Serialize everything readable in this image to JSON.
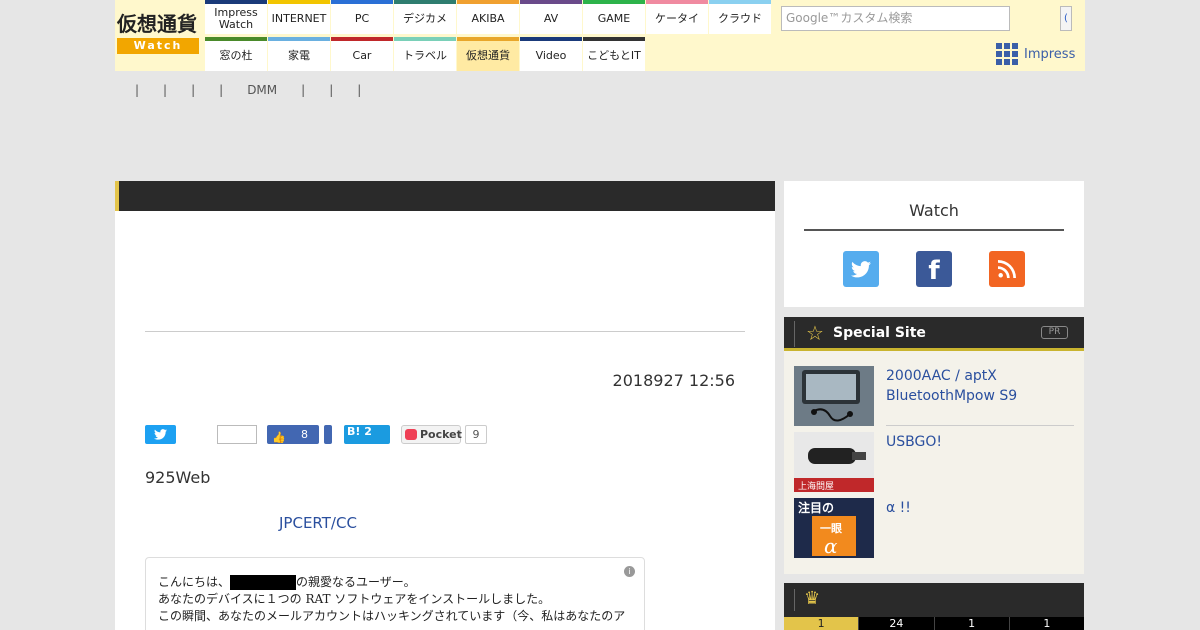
{
  "header": {
    "logo_text": "仮想通貨",
    "logo_sub": "Watch",
    "nav_row1": [
      {
        "label": "Impress\nWatch",
        "color": "#1a3a7a"
      },
      {
        "label": "INTERNET",
        "color": "#f2c500"
      },
      {
        "label": "PC",
        "color": "#2a6fd6"
      },
      {
        "label": "デジカメ",
        "color": "#2e7d6f"
      },
      {
        "label": "AKIBA",
        "color": "#f0a030"
      },
      {
        "label": "AV",
        "color": "#6a4a8a"
      },
      {
        "label": "GAME",
        "color": "#2db34a"
      },
      {
        "label": "ケータイ",
        "color": "#f08aa0"
      },
      {
        "label": "クラウド",
        "color": "#8ad0f0"
      }
    ],
    "nav_row2": [
      {
        "label": "窓の杜",
        "color": "#4a8a2a"
      },
      {
        "label": "家電",
        "color": "#6ab0e0"
      },
      {
        "label": "Car",
        "color": "#c0282a"
      },
      {
        "label": "トラベル",
        "color": "#7ad0b8"
      },
      {
        "label": "仮想通貨",
        "color": "#e8a62a",
        "active": true
      },
      {
        "label": "Video",
        "color": "#1a3a7a"
      },
      {
        "label": "こどもとIT",
        "color": "#333333"
      }
    ],
    "search_placeholder": "Google™カスタム検索",
    "search_button": "(",
    "impress_label": "Impress"
  },
  "subnav": [
    "|",
    "|",
    "|",
    "|",
    "DMM",
    "|",
    "|",
    "|"
  ],
  "article": {
    "date": "2018927 12:56",
    "share": {
      "facebook_count": "8",
      "hatena_label": "B! 2",
      "pocket_label": "Pocket",
      "pocket_count": "9"
    },
    "lead": "925Web",
    "link": "JPCERT/CC",
    "email_lines": [
      "こんにちは、",
      "の親愛なるユーザー。",
      "あなたのデバイスに１つの RAT ソフトウェアをインストールしました。",
      "この瞬間、あなたのメールアカウントはハッキングされています（今、私はあなたのア"
    ]
  },
  "sidebar": {
    "watch_title": "Watch",
    "special_title": "Special Site",
    "pr_label": "PR",
    "special_items": [
      {
        "text": "2000AAC / aptX BluetoothMpow S9"
      },
      {
        "text": "USBGO!"
      },
      {
        "text": "α !!"
      }
    ],
    "ranking_tabs": [
      "1",
      "24",
      "1",
      "1"
    ]
  }
}
